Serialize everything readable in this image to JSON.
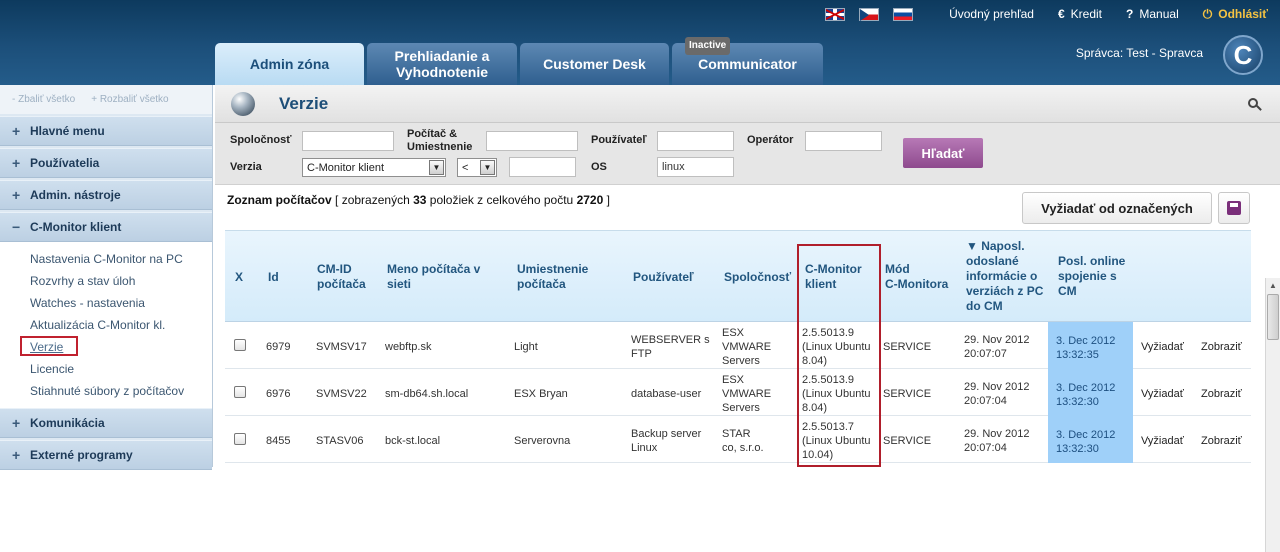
{
  "toplinks": {
    "home": "Úvodný prehľad",
    "credit": "Kredit",
    "credit_icon": "€",
    "manual": "Manual",
    "manual_icon": "?",
    "logout": "Odhlásiť",
    "logout_icon": "⏻"
  },
  "tabs": [
    {
      "label": "Admin zóna"
    },
    {
      "label": "Prehliadanie a\nVyhodnotenie"
    },
    {
      "label": "Customer Desk"
    },
    {
      "label": "Communicator",
      "badge": "Inactive"
    }
  ],
  "user": "Správca: Test - Spravca",
  "logo_letter": "C",
  "sidebar": {
    "collapse_all": "- Zbaliť všetko",
    "expand_all": "+ Rozbaliť všetko",
    "sections": [
      {
        "label": "Hlavné menu",
        "sign": "+"
      },
      {
        "label": "Používatelia",
        "sign": "+"
      },
      {
        "label": "Admin. nástroje",
        "sign": "+"
      },
      {
        "label": "C-Monitor klient",
        "sign": "−"
      }
    ],
    "subitems": [
      "Nastavenia C-Monitor na PC",
      "Rozvrhy a stav úloh",
      "Watches - nastavenia",
      "Aktualizácia C-Monitor kl.",
      "Verzie",
      "Licencie",
      "Stiahnuté súbory z počítačov"
    ],
    "sections_after": [
      {
        "label": "Komunikácia",
        "sign": "+"
      },
      {
        "label": "Externé programy",
        "sign": "+"
      }
    ]
  },
  "page_title": "Verzie",
  "filters": {
    "company_label": "Spoločnosť",
    "computer_label": "Počítač &\nUmiestnenie",
    "user_label": "Používateľ",
    "operator_label": "Operátor",
    "version_label": "Verzia",
    "version_select": "C-Monitor klient",
    "compare_select": "<",
    "os_label": "OS",
    "os_value": "linux",
    "search_button": "Hľadať"
  },
  "list": {
    "prefix": "Zoznam počítačov",
    "shown_text": "[ zobrazených",
    "shown_count": "33",
    "middle_text": "položiek z celkového počtu",
    "total": "2720",
    "end": "]",
    "request_button": "Vyžiadať od označených"
  },
  "table": {
    "headers": {
      "x": "X",
      "id": "Id",
      "cmid": "CM-ID\npočítača",
      "name": "Meno počítača v\nsieti",
      "location": "Umiestnenie\npočítača",
      "user": "Používateľ",
      "company": "Spoločnosť",
      "client": "C-Monitor\nklient",
      "mode": "Mód\nC-Monitora",
      "last_sent": "▼ Naposl.\nodoslané\ninformácie o\nverziách z PC\ndo CM",
      "last_online": "Posl. online\nspojenie s\nCM"
    },
    "rows": [
      {
        "id": "6979",
        "cmid": "SVMSV17",
        "name": "webftp.sk",
        "location": "Light",
        "user": "WEBSERVER s\nFTP",
        "company": "ESX\nVMWARE\nServers",
        "client": "2.5.5013.9\n(Linux Ubuntu\n8.04)",
        "mode": "SERVICE",
        "last_sent": "29. Nov 2012\n20:07:07",
        "last_online": "3. Dec 2012\n13:32:35",
        "action1": "Vyžiadať",
        "action2": "Zobraziť"
      },
      {
        "id": "6976",
        "cmid": "SVMSV22",
        "name": "sm-db64.sh.local",
        "location": "ESX Bryan",
        "user": "database-user",
        "company": "ESX\nVMWARE\nServers",
        "client": "2.5.5013.9\n(Linux Ubuntu\n8.04)",
        "mode": "SERVICE",
        "last_sent": "29. Nov 2012\n20:07:04",
        "last_online": "3. Dec 2012\n13:32:30",
        "action1": "Vyžiadať",
        "action2": "Zobraziť"
      },
      {
        "id": "8455",
        "cmid": "STASV06",
        "name": "bck-st.local",
        "location": "Serverovna",
        "user": "Backup server\nLinux",
        "company": "STAR\nco, s.r.o.",
        "client": "2.5.5013.7\n(Linux Ubuntu\n10.04)",
        "mode": "SERVICE",
        "last_sent": "29. Nov 2012\n20:07:04",
        "last_online": "3. Dec 2012\n13:32:30",
        "action1": "Vyžiadať",
        "action2": "Zobraziť"
      }
    ]
  }
}
